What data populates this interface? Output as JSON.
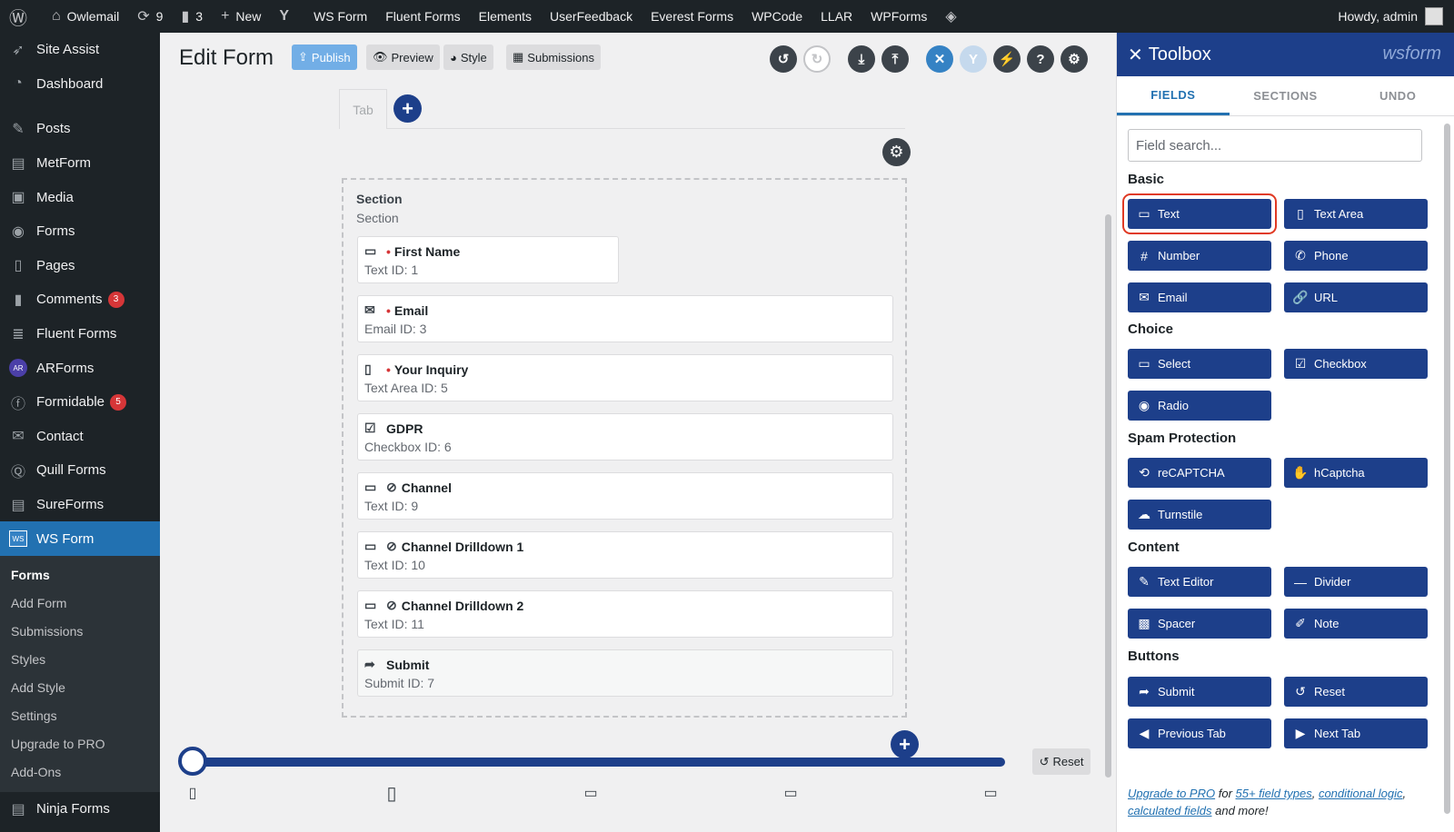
{
  "adminbar": {
    "site": "Owlemail",
    "updates": "9",
    "comments": "3",
    "new": "New",
    "links": [
      "WS Form",
      "Fluent Forms",
      "Elements",
      "UserFeedback",
      "Everest Forms",
      "WPCode",
      "LLAR",
      "WPForms"
    ],
    "howdy": "Howdy, admin"
  },
  "sidebar": {
    "items": [
      {
        "label": "Site Assist",
        "icon": "rocket-icon"
      },
      {
        "label": "Dashboard",
        "icon": "dashboard-icon"
      },
      {
        "label": "Posts",
        "icon": "pin-icon"
      },
      {
        "label": "MetForm",
        "icon": "metform-icon"
      },
      {
        "label": "Media",
        "icon": "media-icon"
      },
      {
        "label": "Forms",
        "icon": "forms-icon"
      },
      {
        "label": "Pages",
        "icon": "pages-icon"
      },
      {
        "label": "Comments",
        "icon": "comment-icon",
        "badge": "3"
      },
      {
        "label": "Fluent Forms",
        "icon": "fluent-icon"
      },
      {
        "label": "ARForms",
        "icon": "arforms-icon"
      },
      {
        "label": "Formidable",
        "icon": "formidable-icon",
        "badge": "5"
      },
      {
        "label": "Contact",
        "icon": "mail-icon"
      },
      {
        "label": "Quill Forms",
        "icon": "quill-icon"
      },
      {
        "label": "SureForms",
        "icon": "sureforms-icon"
      },
      {
        "label": "WS Form",
        "icon": "wsform-icon",
        "active": true
      }
    ],
    "submenu": [
      "Forms",
      "Add Form",
      "Submissions",
      "Styles",
      "Add Style",
      "Settings",
      "Upgrade to PRO",
      "Add-Ons"
    ],
    "after": {
      "label": "Ninja Forms",
      "icon": "ninja-icon"
    }
  },
  "header": {
    "title": "Edit Form",
    "publish": "Publish",
    "preview": "Preview",
    "style": "Style",
    "submissions": "Submissions"
  },
  "form": {
    "tab": "Tab",
    "section_title": "Section",
    "section_sub": "Section",
    "fields": [
      {
        "label": "First Name",
        "sub": "Text  ID: 1",
        "required": true,
        "hidden": false,
        "icon": "text-field-icon"
      },
      {
        "label": "Email",
        "sub": "Email  ID: 3",
        "required": true,
        "hidden": false,
        "icon": "envelope-icon"
      },
      {
        "label": "Your Inquiry",
        "sub": "Text Area  ID: 5",
        "required": true,
        "hidden": false,
        "icon": "textarea-icon"
      },
      {
        "label": "GDPR",
        "sub": "Checkbox  ID: 6",
        "required": false,
        "hidden": false,
        "icon": "checkbox-icon"
      },
      {
        "label": "Channel",
        "sub": "Text  ID: 9",
        "required": false,
        "hidden": true,
        "icon": "text-field-icon"
      },
      {
        "label": "Channel Drilldown 1",
        "sub": "Text  ID: 10",
        "required": false,
        "hidden": true,
        "icon": "text-field-icon"
      },
      {
        "label": "Channel Drilldown 2",
        "sub": "Text  ID: 11",
        "required": false,
        "hidden": true,
        "icon": "text-field-icon"
      },
      {
        "label": "Submit",
        "sub": "Submit  ID: 7",
        "required": false,
        "hidden": false,
        "icon": "submit-arrow-icon"
      }
    ],
    "reset": "Reset"
  },
  "toolbox": {
    "title": "Toolbox",
    "brand": "wsform",
    "tabs": [
      "FIELDS",
      "SECTIONS",
      "UNDO"
    ],
    "search_placeholder": "Field search...",
    "groups": [
      "Basic",
      "Choice",
      "Spam Protection",
      "Content",
      "Buttons"
    ],
    "buttons": [
      "Text",
      "Text Area",
      "Number",
      "Phone",
      "Email",
      "URL",
      "Select",
      "Checkbox",
      "Radio",
      "reCAPTCHA",
      "hCaptcha",
      "Turnstile",
      "Text Editor",
      "Divider",
      "Spacer",
      "Note",
      "Submit",
      "Reset",
      "Previous Tab",
      "Next Tab"
    ],
    "promo": {
      "upgrade": "Upgrade to PRO",
      "for": " for ",
      "field_types": "55+ field types",
      "comma": ", ",
      "conditional": "conditional logic",
      "comma2": ", ",
      "calculated": "calculated fields",
      "more": " and more!"
    }
  },
  "colors": {
    "accent": "#1d3f8a",
    "wp_blue": "#2271b1",
    "highlight": "#e03a24"
  }
}
